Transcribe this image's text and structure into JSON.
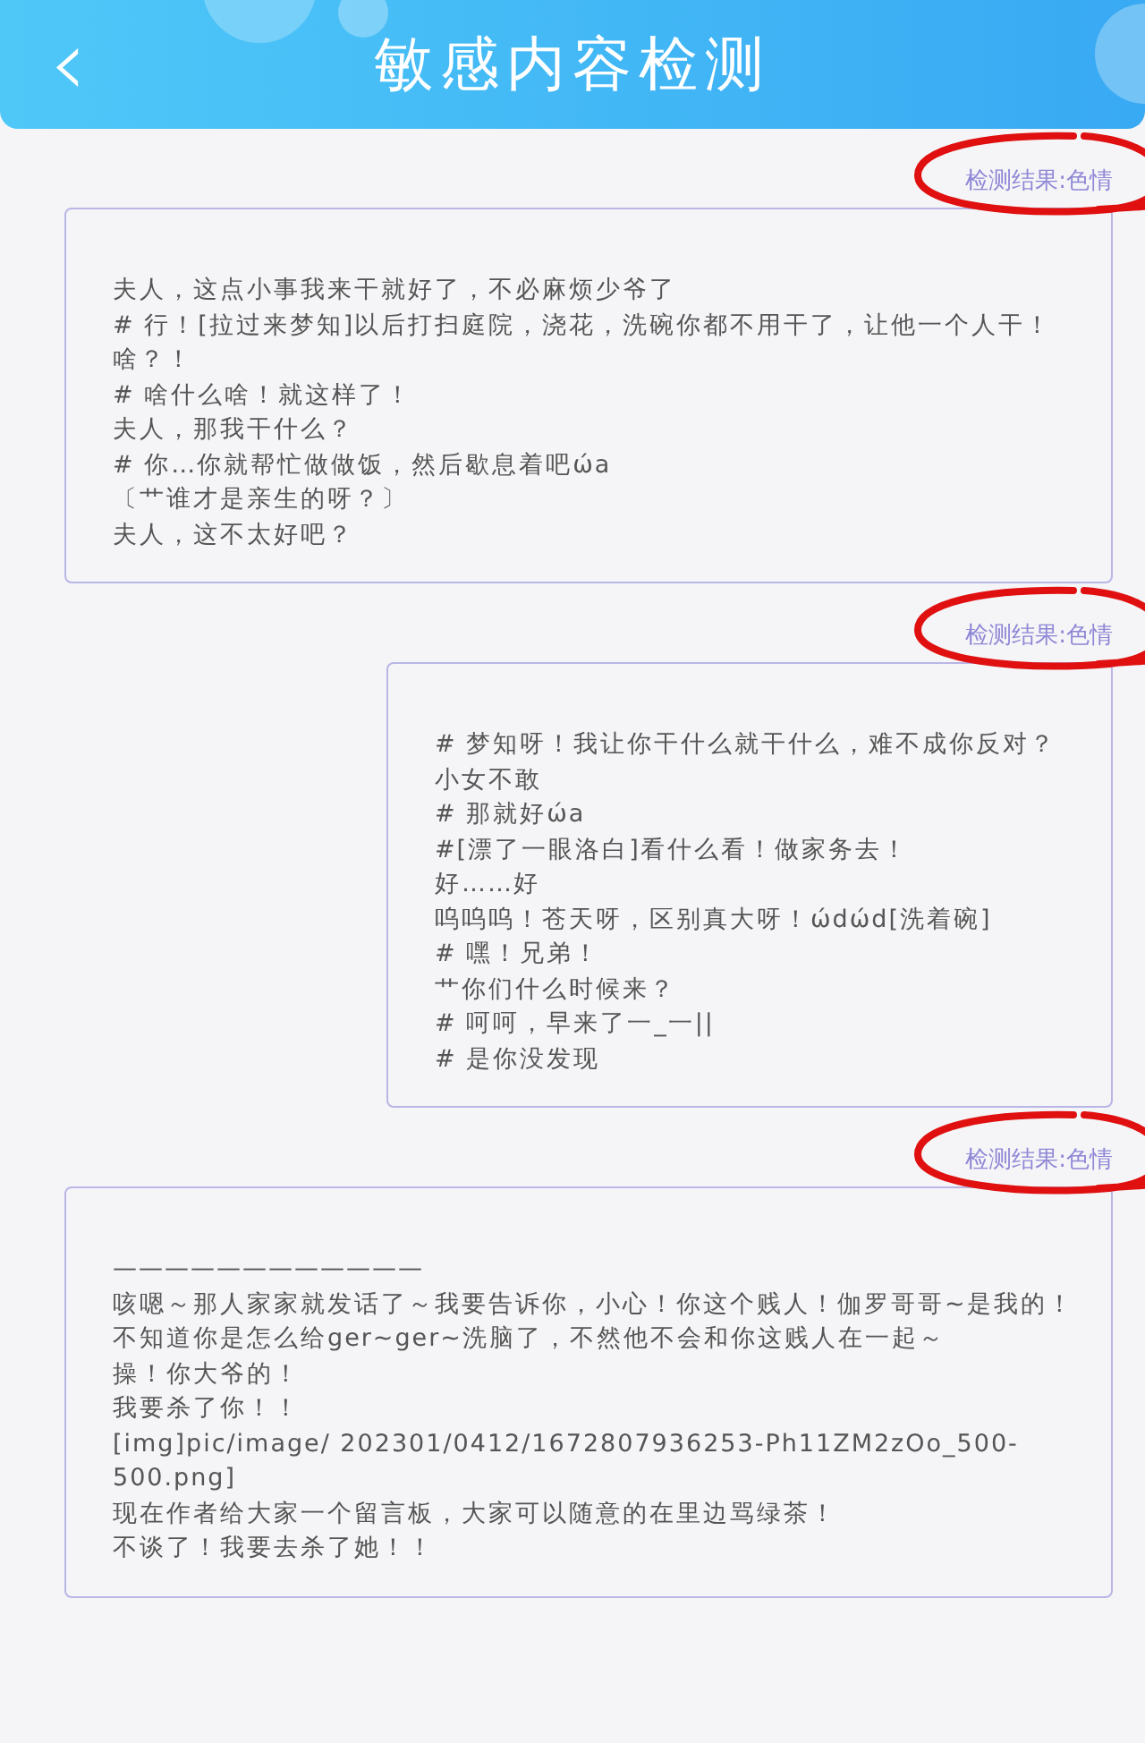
{
  "header": {
    "back": "‹",
    "title": "敏感内容检测"
  },
  "results": [
    {
      "label": "检测结果:色情",
      "highlighted": true,
      "indented": false,
      "lines": [
        "夫人，这点小事我来干就好了，不必麻烦少爷了",
        "# 行！[拉过来梦知]以后打扫庭院，浇花，洗碗你都不用干了，让他一个人干！",
        "啥？！",
        "# 啥什么啥！就这样了！",
        "夫人，那我干什么？",
        "# 你…你就帮忙做做饭，然后歇息着吧ώa",
        "〔艹谁才是亲生的呀？〕",
        "夫人，这不太好吧？"
      ]
    },
    {
      "label": "检测结果:色情",
      "highlighted": true,
      "indented": true,
      "lines": [
        "# 梦知呀！我让你干什么就干什么，难不成你反对？",
        "小女不敢",
        "# 那就好ώa",
        "#[漂了一眼洛白]看什么看！做家务去！",
        "好……好",
        "呜呜呜！苍天呀，区别真大呀！ώdώd[洗着碗]",
        "# 嘿！兄弟！",
        "艹你们什么时候来？",
        "# 呵呵，早来了一_一||",
        "# 是你没发现"
      ]
    },
    {
      "label": "检测结果:色情",
      "highlighted": true,
      "indented": false,
      "lines": [
        "————————————",
        "咳嗯～那人家家就发话了～我要告诉你，小心！你这个贱人！伽罗哥哥~是我的！",
        "不知道你是怎么给ger~ger~洗脑了，不然他不会和你这贱人在一起～",
        "操！你大爷的！",
        "我要杀了你！！",
        "[img]pic/image/ 202301/0412/1672807936253-Ph11ZM2zOo_500-500.png]",
        "现在作者给大家一个留言板，大家可以随意的在里边骂绿茶！",
        "不谈了！我要去杀了她！！"
      ]
    }
  ]
}
